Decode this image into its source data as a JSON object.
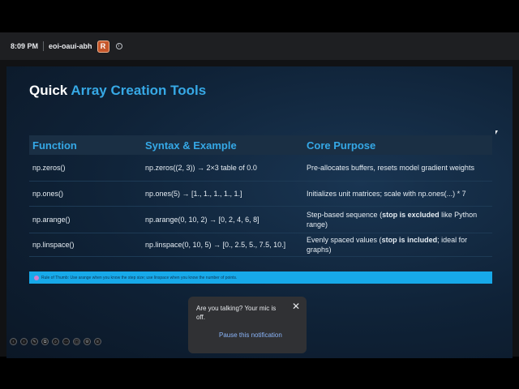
{
  "meeting": {
    "time": "8:09 PM",
    "code": "eoi-oaui-abh",
    "presenter_icon": "R",
    "info_icon": "info-icon"
  },
  "slide": {
    "title_plain": "Quick ",
    "title_accent": "Array Creation Tools",
    "columns": [
      "Function",
      "Syntax & Example",
      "Core Purpose"
    ],
    "rows": [
      {
        "function": "np.zeros()",
        "syntax": "np.zeros((2, 3)) → 2×3 table of 0.0",
        "purpose": "Pre-allocates buffers, resets model gradient weights"
      },
      {
        "function": "np.ones()",
        "syntax": "np.ones(5) → [1., 1., 1., 1., 1.]",
        "purpose": "Initializes unit matrices; scale with np.ones(...) * 7"
      },
      {
        "function": "np.arange()",
        "syntax": "np.arange(0, 10, 2) → [0, 2, 4, 6, 8]",
        "purpose_pre": "Step-based sequence (",
        "purpose_bold": "stop is excluded",
        "purpose_post": " like Python range)"
      },
      {
        "function": "np.linspace()",
        "syntax": "np.linspace(0, 10, 5) → [0., 2.5, 5., 7.5, 10.]",
        "purpose_pre": "Evenly spaced values (",
        "purpose_bold": "stop is included",
        "purpose_post": "; ideal for graphs)"
      }
    ],
    "rule_of_thumb": "Rule of Thumb: Use arange when you know the step size; use linspace when you know the number of points."
  },
  "toast": {
    "message": "Are you talking? Your mic is off.",
    "action": "Pause this notification",
    "close_icon": "close-icon"
  },
  "slide_tools": [
    "prev",
    "next",
    "pen",
    "copy",
    "search",
    "more",
    "fit",
    "settings",
    "menu"
  ],
  "colors": {
    "accent": "#37a9e6",
    "rule_bar": "#17a9e9",
    "toast_action": "#8ab4f8"
  }
}
